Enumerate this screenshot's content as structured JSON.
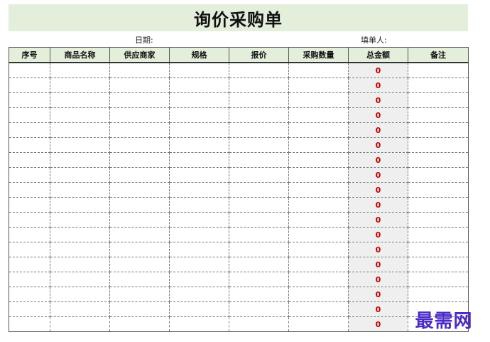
{
  "sheet": {
    "title": "询价采购单",
    "date_label": "日期:",
    "filler_label": "填单人:"
  },
  "table": {
    "columns": [
      "序号",
      "商品名称",
      "供应商家",
      "规格",
      "报价",
      "采购数量",
      "总金额",
      "备注"
    ],
    "rows": [
      {
        "index": "",
        "name": "",
        "supplier": "",
        "spec": "",
        "price": "",
        "qty": "",
        "total": "0",
        "note": ""
      },
      {
        "index": "",
        "name": "",
        "supplier": "",
        "spec": "",
        "price": "",
        "qty": "",
        "total": "0",
        "note": ""
      },
      {
        "index": "",
        "name": "",
        "supplier": "",
        "spec": "",
        "price": "",
        "qty": "",
        "total": "0",
        "note": ""
      },
      {
        "index": "",
        "name": "",
        "supplier": "",
        "spec": "",
        "price": "",
        "qty": "",
        "total": "0",
        "note": ""
      },
      {
        "index": "",
        "name": "",
        "supplier": "",
        "spec": "",
        "price": "",
        "qty": "",
        "total": "0",
        "note": ""
      },
      {
        "index": "",
        "name": "",
        "supplier": "",
        "spec": "",
        "price": "",
        "qty": "",
        "total": "0",
        "note": ""
      },
      {
        "index": "",
        "name": "",
        "supplier": "",
        "spec": "",
        "price": "",
        "qty": "",
        "total": "0",
        "note": ""
      },
      {
        "index": "",
        "name": "",
        "supplier": "",
        "spec": "",
        "price": "",
        "qty": "",
        "total": "0",
        "note": ""
      },
      {
        "index": "",
        "name": "",
        "supplier": "",
        "spec": "",
        "price": "",
        "qty": "",
        "total": "0",
        "note": ""
      },
      {
        "index": "",
        "name": "",
        "supplier": "",
        "spec": "",
        "price": "",
        "qty": "",
        "total": "0",
        "note": ""
      },
      {
        "index": "",
        "name": "",
        "supplier": "",
        "spec": "",
        "price": "",
        "qty": "",
        "total": "0",
        "note": ""
      },
      {
        "index": "",
        "name": "",
        "supplier": "",
        "spec": "",
        "price": "",
        "qty": "",
        "total": "0",
        "note": ""
      },
      {
        "index": "",
        "name": "",
        "supplier": "",
        "spec": "",
        "price": "",
        "qty": "",
        "total": "0",
        "note": ""
      },
      {
        "index": "",
        "name": "",
        "supplier": "",
        "spec": "",
        "price": "",
        "qty": "",
        "total": "0",
        "note": ""
      },
      {
        "index": "",
        "name": "",
        "supplier": "",
        "spec": "",
        "price": "",
        "qty": "",
        "total": "0",
        "note": ""
      },
      {
        "index": "",
        "name": "",
        "supplier": "",
        "spec": "",
        "price": "",
        "qty": "",
        "total": "0",
        "note": ""
      },
      {
        "index": "",
        "name": "",
        "supplier": "",
        "spec": "",
        "price": "",
        "qty": "",
        "total": "0",
        "note": ""
      },
      {
        "index": "",
        "name": "",
        "supplier": "",
        "spec": "",
        "price": "",
        "qty": "",
        "total": "0",
        "note": ""
      }
    ]
  },
  "watermark": {
    "text": "最需网"
  },
  "colors": {
    "header_bg": "#e3eedb",
    "total_text": "#c00000",
    "total_bg": "#efefef",
    "watermark": "#4b2ac8"
  }
}
